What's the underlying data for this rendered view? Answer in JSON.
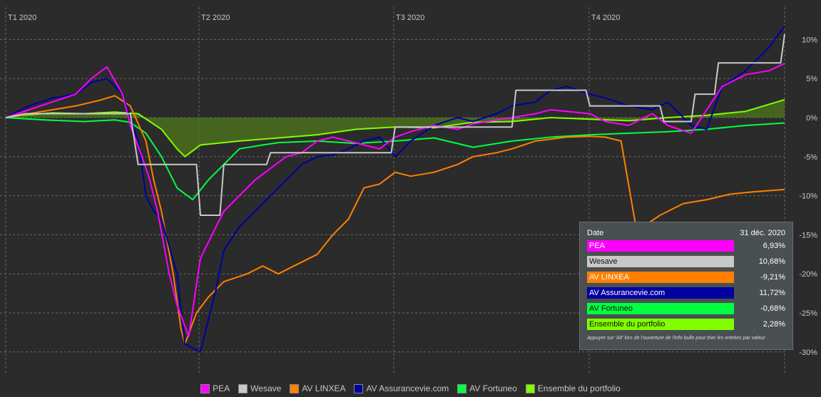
{
  "colors": {
    "PEA": "#ff00ff",
    "Wesave": "#c8c8c8",
    "AV LINXEA": "#ff8000",
    "AV Assurancevie.com": "#0000a0",
    "AV Fortuneo": "#00ff40",
    "Ensemble du portfolio": "#80ff00"
  },
  "chart_data": {
    "type": "line",
    "quarter_labels": [
      "T1 2020",
      "T2 2020",
      "T3 2020",
      "T4 2020"
    ],
    "y_ticks": [
      "10%",
      "5%",
      "0%",
      "-5%",
      "-10%",
      "-15%",
      "-20%",
      "-25%",
      "-30%"
    ],
    "y_tick_values": [
      10,
      5,
      0,
      -5,
      -10,
      -15,
      -20,
      -25,
      -30
    ],
    "ylim": [
      -32,
      13
    ],
    "xlim": [
      0,
      1
    ],
    "series": [
      {
        "name": "Ensemble du portfolio",
        "fill": true,
        "x": [
          0,
          0.02,
          0.06,
          0.1,
          0.14,
          0.17,
          0.2,
          0.22,
          0.23,
          0.25,
          0.3,
          0.35,
          0.4,
          0.45,
          0.5,
          0.55,
          0.6,
          0.65,
          0.7,
          0.75,
          0.8,
          0.85,
          0.9,
          0.95,
          1
        ],
        "y": [
          0,
          0.3,
          0.6,
          0.5,
          0.7,
          0.5,
          -1.5,
          -4,
          -5,
          -3.5,
          -3,
          -2.6,
          -2.2,
          -1.5,
          -1.2,
          -1.3,
          -0.6,
          -0.5,
          0,
          -0.2,
          -0.4,
          0,
          0.3,
          0.8,
          2.3
        ]
      },
      {
        "name": "AV Fortuneo",
        "x": [
          0,
          0.05,
          0.1,
          0.14,
          0.16,
          0.18,
          0.2,
          0.22,
          0.24,
          0.26,
          0.3,
          0.33,
          0.35,
          0.4,
          0.45,
          0.5,
          0.55,
          0.6,
          0.65,
          0.7,
          0.75,
          0.8,
          0.85,
          0.9,
          0.95,
          1
        ],
        "y": [
          0,
          -0.3,
          -0.5,
          -0.3,
          -0.6,
          -2,
          -5,
          -9,
          -10.5,
          -8,
          -4,
          -3.5,
          -3.2,
          -3,
          -3.3,
          -3,
          -2.6,
          -3.8,
          -3,
          -2.5,
          -2.2,
          -2,
          -1.8,
          -1.5,
          -1,
          -0.68
        ]
      },
      {
        "name": "AV LINXEA",
        "x": [
          0,
          0.03,
          0.06,
          0.09,
          0.12,
          0.14,
          0.16,
          0.18,
          0.19,
          0.2,
          0.215,
          0.225,
          0.23,
          0.245,
          0.26,
          0.28,
          0.31,
          0.33,
          0.35,
          0.37,
          0.4,
          0.42,
          0.44,
          0.46,
          0.48,
          0.5,
          0.52,
          0.55,
          0.58,
          0.6,
          0.63,
          0.65,
          0.68,
          0.72,
          0.75,
          0.77,
          0.79,
          0.81,
          0.84,
          0.87,
          0.9,
          0.93,
          0.96,
          1
        ],
        "y": [
          0,
          0.5,
          1,
          1.5,
          2.2,
          2.8,
          1.5,
          -3,
          -8,
          -12,
          -20,
          -27,
          -29,
          -25,
          -23,
          -21,
          -20,
          -19,
          -20,
          -19,
          -17.5,
          -15,
          -13,
          -9,
          -8.5,
          -7,
          -7.5,
          -7,
          -6,
          -5,
          -4.5,
          -4,
          -3,
          -2.5,
          -2.4,
          -2.5,
          -3,
          -14.5,
          -12.5,
          -11,
          -10.5,
          -9.8,
          -9.5,
          -9.21
        ]
      },
      {
        "name": "AV Assurancevie.com",
        "x": [
          0,
          0.03,
          0.06,
          0.09,
          0.11,
          0.13,
          0.15,
          0.17,
          0.18,
          0.19,
          0.2,
          0.22,
          0.23,
          0.25,
          0.27,
          0.28,
          0.3,
          0.32,
          0.34,
          0.36,
          0.38,
          0.4,
          0.42,
          0.44,
          0.46,
          0.48,
          0.5,
          0.52,
          0.55,
          0.58,
          0.6,
          0.63,
          0.65,
          0.68,
          0.7,
          0.72,
          0.75,
          0.77,
          0.8,
          0.83,
          0.85,
          0.88,
          0.9,
          0.92,
          0.95,
          0.98,
          1
        ],
        "y": [
          0,
          1.5,
          2.5,
          3,
          4.5,
          5,
          3,
          -3,
          -10,
          -12,
          -13,
          -20,
          -29,
          -30,
          -22,
          -17,
          -14,
          -12,
          -10,
          -8,
          -6,
          -5,
          -4.8,
          -4,
          -3,
          -2.5,
          -5,
          -3,
          -1,
          0,
          -0.5,
          0.5,
          1.5,
          2,
          3.5,
          4,
          3,
          2.5,
          1.5,
          1,
          2,
          -1,
          -1.5,
          4,
          6,
          9,
          11.72
        ]
      },
      {
        "name": "PEA",
        "x": [
          0,
          0.03,
          0.06,
          0.09,
          0.11,
          0.13,
          0.15,
          0.16,
          0.175,
          0.185,
          0.195,
          0.21,
          0.22,
          0.235,
          0.25,
          0.27,
          0.28,
          0.3,
          0.32,
          0.34,
          0.36,
          0.38,
          0.4,
          0.42,
          0.44,
          0.46,
          0.48,
          0.5,
          0.52,
          0.55,
          0.58,
          0.6,
          0.63,
          0.65,
          0.68,
          0.7,
          0.72,
          0.75,
          0.77,
          0.8,
          0.83,
          0.85,
          0.88,
          0.9,
          0.92,
          0.95,
          0.98,
          1
        ],
        "y": [
          0,
          1,
          2,
          3,
          5,
          6.5,
          3,
          -1,
          -5,
          -8,
          -12,
          -20,
          -24,
          -28,
          -18,
          -14,
          -12,
          -10,
          -8,
          -6.5,
          -5,
          -4.5,
          -3,
          -2.5,
          -3,
          -3.5,
          -4,
          -2.5,
          -1.8,
          -1,
          -1.5,
          -0.8,
          -0.3,
          0,
          0.5,
          1,
          0.8,
          0.5,
          -0.5,
          -1,
          0.5,
          -1,
          -2,
          1,
          4,
          5.5,
          6,
          6.93
        ]
      },
      {
        "name": "Wesave",
        "step": true,
        "x": [
          0,
          0.025,
          0.16,
          0.17,
          0.245,
          0.25,
          0.275,
          0.28,
          0.335,
          0.34,
          0.495,
          0.5,
          0.65,
          0.655,
          0.745,
          0.75,
          0.84,
          0.845,
          0.88,
          0.885,
          0.91,
          0.915,
          0.995,
          1
        ],
        "y": [
          0,
          0.5,
          0.5,
          -6,
          -6,
          -12.5,
          -12.5,
          -6,
          -6,
          -4.5,
          -4.5,
          -1.2,
          -1.2,
          3.5,
          3.5,
          1.5,
          1.5,
          -0.5,
          -0.5,
          3,
          3,
          7,
          7,
          10.68
        ]
      }
    ]
  },
  "legend": {
    "items": [
      "PEA",
      "Wesave",
      "AV LINXEA",
      "AV Assurancevie.com",
      "AV Fortuneo",
      "Ensemble du portfolio"
    ]
  },
  "tooltip": {
    "date_label": "Date",
    "date_value": "31 déc. 2020",
    "rows": [
      {
        "label": "PEA",
        "value": "6,93%"
      },
      {
        "label": "Wesave",
        "value": "10,68%"
      },
      {
        "label": "AV LINXEA",
        "value": "-9,21%"
      },
      {
        "label": "AV Assurancevie.com",
        "value": "11,72%"
      },
      {
        "label": "AV Fortuneo",
        "value": "-0,68%"
      },
      {
        "label": "Ensemble du portfolio",
        "value": "2,28%"
      }
    ],
    "note": "Appuyer sur 'Alt' lors de l'ouverture de l'info bulle pour trier les entrées par valeur"
  }
}
